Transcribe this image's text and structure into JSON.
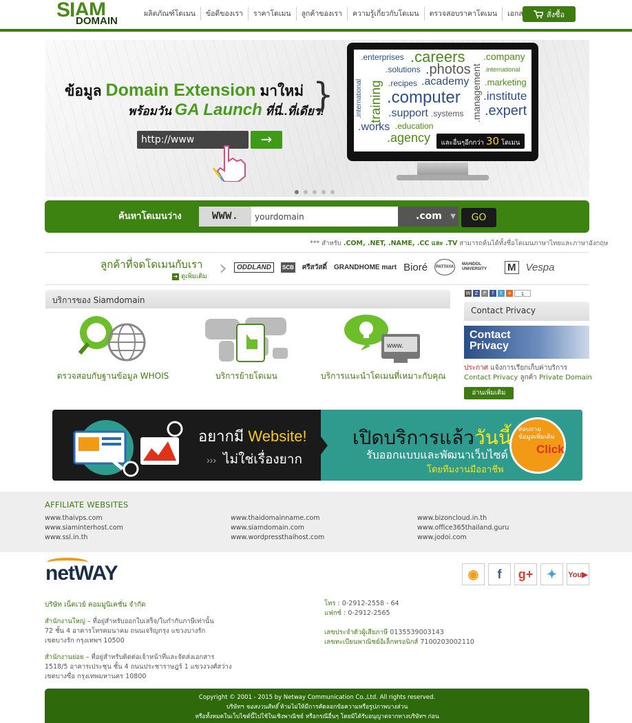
{
  "brand": {
    "logo_top": "SIAM",
    "logo_bottom": "DOMAIN"
  },
  "nav": {
    "items": [
      "ผลิตภัณฑ์โดเมน",
      "ข้อดีของเรา",
      "ราคาโดเมน",
      "ลูกค้าของเรา",
      "ความรู้เกี่ยวกับโดเมน",
      "ตรวจสอบราคาโดเมน",
      "เอกสารที่ต้องใช้"
    ],
    "cart_label": "สั่งซื้อ"
  },
  "hero": {
    "line1_a": "ข้อมูล",
    "line1_b": "Domain Extension",
    "line1_c": "มาใหม่",
    "line2_a": "พร้อมวัน",
    "line2_b": "GA Launch",
    "line2_c": "ที่นี่..ที่เดียว!",
    "url_text": "http://www",
    "badge_a": "และอื่นๆอีกกว่า",
    "badge_num": "30",
    "badge_b": "โดเมน",
    "words": [
      ".enterprises",
      ".careers",
      ".company",
      ".solutions",
      ".photos",
      ".international",
      ".recipes",
      ".academy",
      ".marketing",
      ".international",
      ".training",
      ".computer",
      ".management",
      ".institute",
      ".expert",
      ".systems",
      ".support",
      ".works",
      ".education",
      ".agency"
    ]
  },
  "search": {
    "label": "ค้นหาโดเมนว่าง",
    "prefix": "WWW.",
    "value": "yourdomain",
    "tld": ".com",
    "go": "GO",
    "note_a": "*** สำหรับ",
    "note_tlds": ".COM, .NET, .NAME, .CC และ .TV",
    "note_b": "สามารถค้นได้ทั้งชื่อโดเมนภาษาไทยและภาษาอังกฤษ"
  },
  "clients": {
    "title": "ลูกค้าที่จดโดเมนกับเรา",
    "more": "ดูเพิ่มเติม",
    "logos": [
      "ODDLAND",
      "SCB",
      "ศรีสวัสดิ์",
      "GRANDHOME mart",
      "Bioré",
      "PATTAYA",
      "MAHIDOL UNIVERSITY",
      "M",
      "Vespa"
    ]
  },
  "services": {
    "title": "บริการของ Siamdomain",
    "items": [
      "ตรวจสอบกับฐานข้อมูล WHOIS",
      "บริการย้ายโดเมน",
      "บริการแนะนำโดเมนที่เหมาะกับคุณ"
    ]
  },
  "sidebar": {
    "share_count": "1",
    "title": "Contact Privacy",
    "img_text": "Contact Privacy",
    "text_a": "ประกาศ",
    "text_b": "แจ้งการเรียกเก็บค่าบริการ",
    "text_c": "Contact Privacy",
    "text_d": "ลูกค้า",
    "text_e": "Private Domain",
    "more": "อ่านเพิ่มเติม"
  },
  "banner": {
    "l1_a": "อยากมี",
    "l1_b": "Website!",
    "l2": "ไม่ใช่เรื่องยาก",
    "r1_a": "เปิดบริการแล้ว",
    "r1_b": "วันนี้",
    "r2": "รับออกแบบและพัฒนาเว็บไซต์",
    "r3": "โดยทีมงานมืออาชีพ",
    "click_a": "สอบถามข้อมูลเพิ่มเติม",
    "click_b": "Click"
  },
  "affiliate": {
    "title": "AFFILIATE WEBSITES",
    "col1": [
      "www.thaivps.com",
      "www.siaminterhost.com",
      "www.ssl.in.th"
    ],
    "col2": [
      "www.thaidomainname.com",
      "www.siamdomain.com",
      "www.wordpressthaihost.com"
    ],
    "col3": [
      "www.bizoncloud.in.th",
      "www.office365thailand.guru",
      "www.jodoi.com"
    ]
  },
  "footer": {
    "brand": "netWAY",
    "company": "บริษัท เน็ตเวย์ คอมมูนิเคชั่น จำกัด",
    "hq_label": "สำนักงานใหญ่",
    "hq_note": "– ที่อยู่สำหรับออกใบเสร็จ/ใบกำกับภาษีเท่านั้น",
    "hq_1": "72 ชั้น 4 อาคารโทรคมนาคม ถนนเจริญกรุง แขวงบางรัก",
    "hq_2": "เขตบางรัก กรุงเทพฯ 10500",
    "br_label": "สำนักงานย่อย",
    "br_note": "– ที่อยู่สำหรับติดต่อเจ้าหน้าที่และจัดส่งเอกสาร",
    "br_1": "1518/5 อาคารเประชุน ชั้น 4 ถนนประชาราษฎร์ 1 แขวงวงศ์สว่าง",
    "br_2": "เขตบางซื่อ กรุงเทพมหานคร 10800",
    "tel_label": "โทร",
    "tel": ": 0-2912-2558 - 64",
    "fax_label": "แฟกซ์",
    "fax": ": 0-2912-2565",
    "tax_label": "เลขประจำตัวผู้เสียภาษี",
    "tax": "0135539003143",
    "ecom_label": "เลขทะเบียนพาณิชย์อิเล็กทรอนิกส์",
    "ecom": "7100203002110",
    "copyright": "Copyright © 2001 - 2015 by Netway Communication Co.,Ltd. All rights reserved.",
    "legal_1_a": "บริษัทฯ",
    "legal_1_b": "ขอสงวนสิทธิ์",
    "legal_1_c": "ห้ามไม่ให้มีการคัดลอกข้อความหรือรูปภาพบางส่วน",
    "legal_2": "หรือทั้งหมดในเว็บไซต์นี้ไปใช้ในเชิงพาณิชย์ หรือกรณีอื่นๆ โดยมิได้รับอนุญาตจากทางบริษัทฯ ก่อน"
  }
}
